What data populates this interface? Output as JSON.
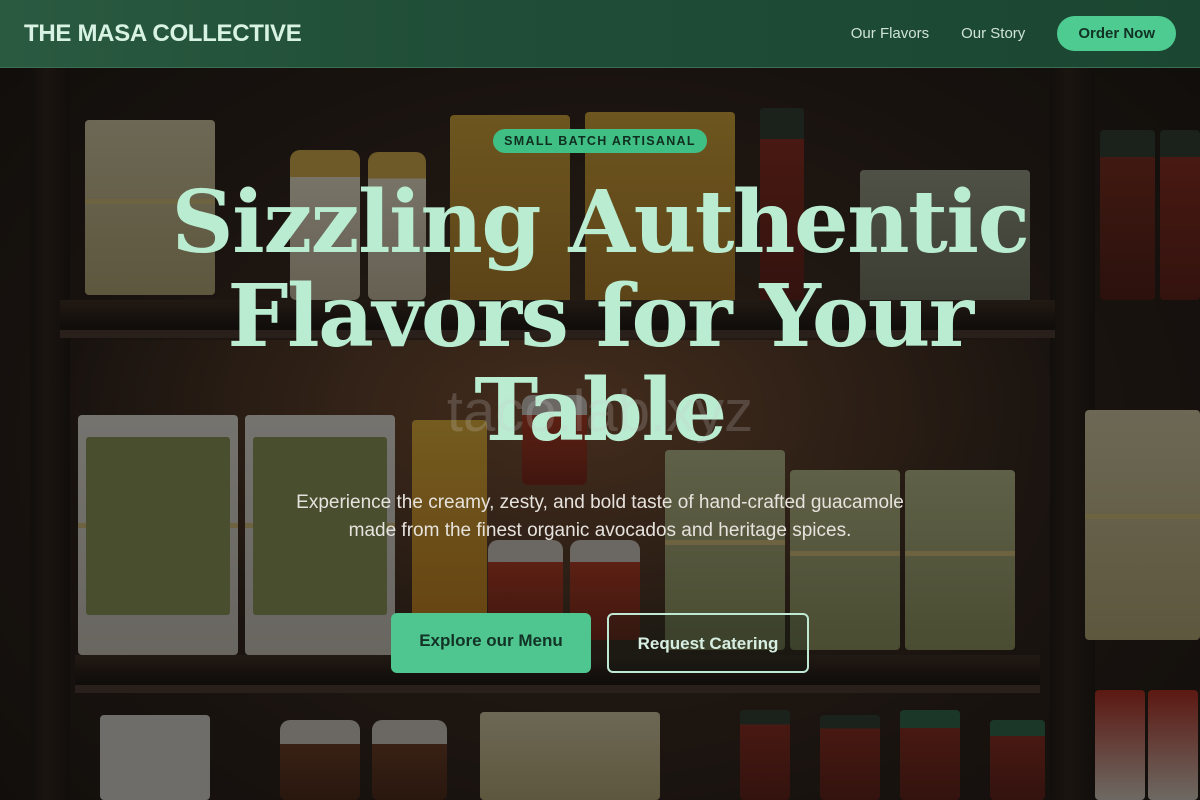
{
  "header": {
    "brand": "THE MASA COLLECTIVE",
    "nav": [
      {
        "label": "Our Flavors"
      },
      {
        "label": "Our Story"
      }
    ],
    "cta_label": "Order Now"
  },
  "hero": {
    "badge": "SMALL BATCH ARTISANAL",
    "title": "Sizzling Authentic Flavors for Your Table",
    "watermark": "taco.lab.xyz",
    "subtitle": "Experience the creamy, zesty, and bold taste of hand-crafted guacamole made from the finest organic avocados and heritage spices.",
    "primary_button": "Explore our Menu",
    "secondary_button": "Request Catering"
  },
  "colors": {
    "header_bg": "#1f4d37",
    "accent": "#4ecb91",
    "title_text": "#b9ecd0"
  }
}
